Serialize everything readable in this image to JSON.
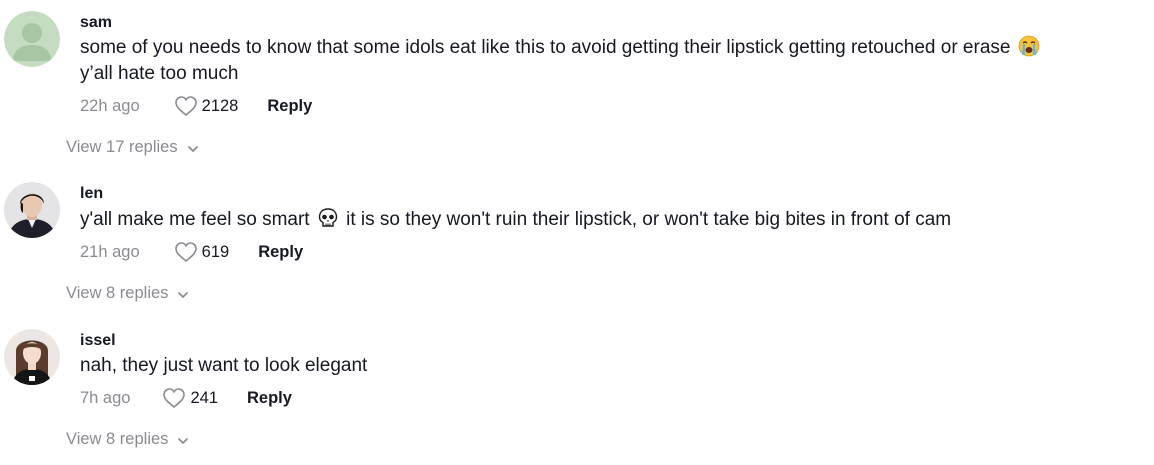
{
  "comments": [
    {
      "username": "sam",
      "avatar": "default-person-avatar",
      "lines": [
        "some of you needs to know that some idols eat like this to avoid getting their lipstick getting retouched or erase",
        "y’all hate too much"
      ],
      "emoji": "loudly-crying-face-emoji",
      "timestamp": "22h ago",
      "likes": "2128",
      "reply_label": "Reply",
      "view_replies": "View 17 replies"
    },
    {
      "username": "len",
      "avatar": "person-photo-avatar",
      "line_before_emoji": "y'all make me feel so smart",
      "emoji": "skull-emoji",
      "line_after_emoji": "it is so they won't ruin their lipstick, or won't take big bites in front of cam",
      "timestamp": "21h ago",
      "likes": "619",
      "reply_label": "Reply",
      "view_replies": "View 8 replies"
    },
    {
      "username": "issel",
      "avatar": "person-photo-avatar",
      "lines": [
        "nah, they just want to look elegant"
      ],
      "timestamp": "7h ago",
      "likes": "241",
      "reply_label": "Reply",
      "view_replies": "View 8 replies"
    }
  ],
  "colors": {
    "text_primary": "#161823",
    "text_secondary": "#8a8b91",
    "default_avatar_bg": "#c5dcc2",
    "default_avatar_fg": "#a7c6a4"
  }
}
